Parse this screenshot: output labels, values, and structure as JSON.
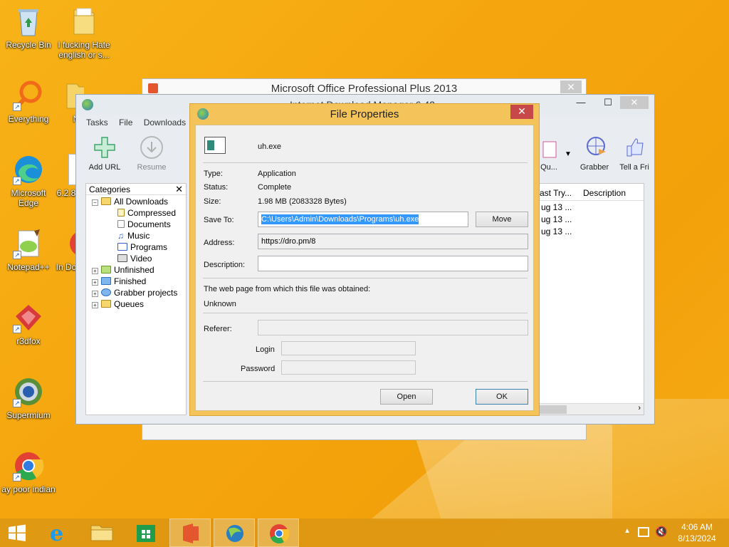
{
  "desktop": {
    "icons": [
      {
        "label": "Recycle Bin"
      },
      {
        "label": "I fucking Hate english or s..."
      },
      {
        "label": "Everything"
      },
      {
        "label": "Ne"
      },
      {
        "label": "Microsoft Edge"
      },
      {
        "label": "6.2.8"
      },
      {
        "label": "Notepad++"
      },
      {
        "label": "In Do"
      },
      {
        "label": "r3dfox"
      },
      {
        "label": "Supermium"
      },
      {
        "label": "ay poor indian"
      }
    ]
  },
  "office_window": {
    "title": "Microsoft Office Professional Plus 2013",
    "close": "✕"
  },
  "idm_window": {
    "title": "Internet Download Manager 6.42",
    "menu": [
      "Tasks",
      "File",
      "Downloads"
    ],
    "toolbar": {
      "add_url": "Add URL",
      "resume": "Resume",
      "queue": "Qu...",
      "grabber": "Grabber",
      "tell": "Tell a Fri"
    },
    "categories": {
      "header": "Categories",
      "close": "✕",
      "items": [
        "All Downloads",
        "Compressed",
        "Documents",
        "Music",
        "Programs",
        "Video",
        "Unfinished",
        "Finished",
        "Grabber projects",
        "Queues"
      ]
    },
    "list": {
      "col_last_try": "ast Try...",
      "col_description": "Description",
      "rows": [
        "ug 13 ...",
        "ug 13 ...",
        "ug 13 ..."
      ]
    },
    "controls": {
      "minimize": "—",
      "maximize": "☐",
      "close": "✕"
    }
  },
  "dialog": {
    "title": "File Properties",
    "close": "✕",
    "filename": "uh.exe",
    "type_label": "Type:",
    "type_value": "Application",
    "status_label": "Status:",
    "status_value": "Complete",
    "size_label": "Size:",
    "size_value": "1.98  MB (2083328 Bytes)",
    "save_to_label": "Save To:",
    "save_to_value": "C:\\Users\\Admin\\Downloads\\Programs\\uh.exe",
    "move_button": "Move",
    "address_label": "Address:",
    "address_value": "https://dro.pm/8",
    "description_label": "Description:",
    "description_value": "",
    "webpage_label": "The web page from which this file was obtained:",
    "webpage_value": "Unknown",
    "referer_label": "Referer:",
    "login_label": "Login",
    "password_label": "Password",
    "open_button": "Open",
    "ok_button": "OK"
  },
  "taskbar": {
    "time": "4:06 AM",
    "date": "8/13/2024"
  }
}
